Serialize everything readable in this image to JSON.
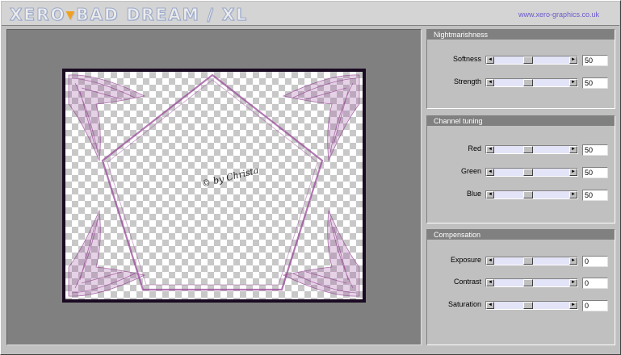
{
  "app": {
    "title_left": "XERO",
    "title_right": "BAD DREAM / XL",
    "url": "www.xero-graphics.co.uk"
  },
  "preview": {
    "signature": "© by Christa"
  },
  "panels": [
    {
      "title": "Nightmarishness",
      "controls": [
        {
          "label": "Softness",
          "value": "50"
        },
        {
          "label": "Strength",
          "value": "50"
        }
      ]
    },
    {
      "title": "Channel tuning",
      "controls": [
        {
          "label": "Red",
          "value": "50"
        },
        {
          "label": "Green",
          "value": "50"
        },
        {
          "label": "Blue",
          "value": "50"
        }
      ]
    },
    {
      "title": "Compensation",
      "controls": [
        {
          "label": "Exposure",
          "value": "0"
        },
        {
          "label": "Contrast",
          "value": "0"
        },
        {
          "label": "Saturation",
          "value": "0"
        }
      ]
    }
  ],
  "icons": {
    "slider_left": "left-arrow-icon",
    "slider_right": "right-arrow-icon",
    "title_separator": "triangle-down-icon"
  },
  "colors": {
    "preview_bg": "#808080",
    "slider_track": "#e4e4f8",
    "ornament": "#9a4a9a",
    "panel_header": "#808080"
  }
}
